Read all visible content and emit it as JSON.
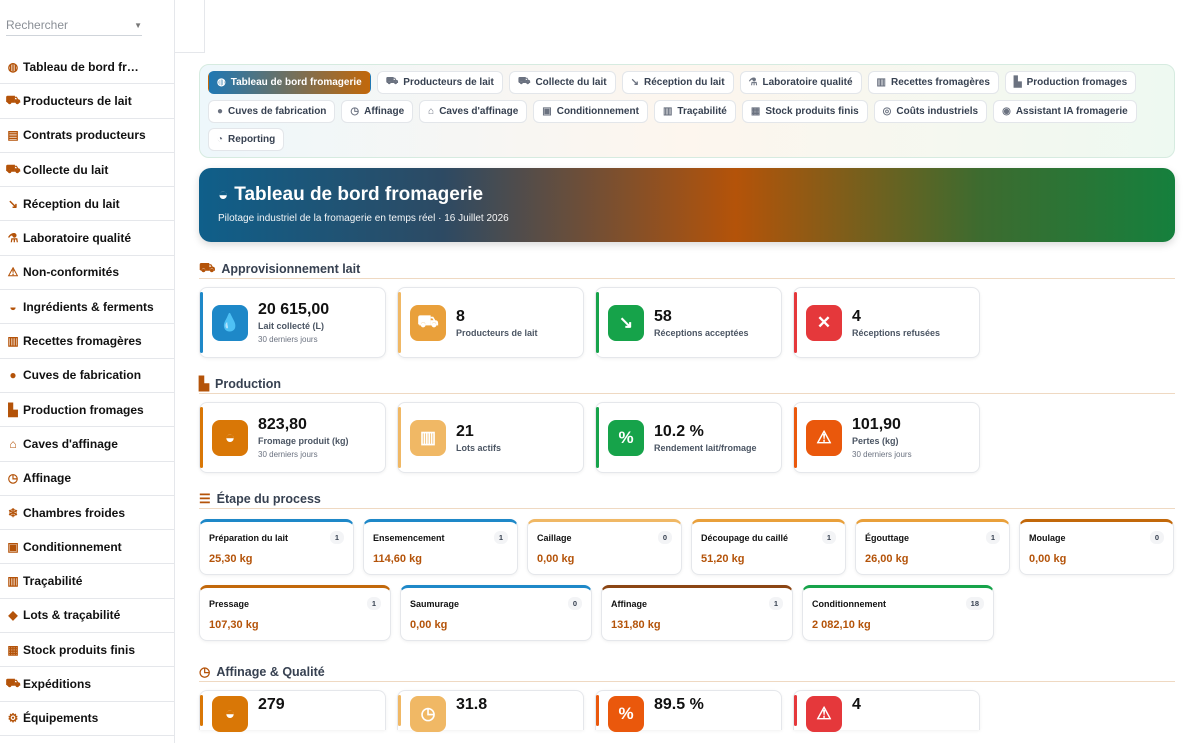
{
  "sidebar": {
    "search_placeholder": "Rechercher",
    "items": [
      {
        "label": "Tableau de bord fromagerie",
        "display": "Tableau de bord fromagerie",
        "icon": "gauge-icon",
        "glyph": "◍"
      },
      {
        "label": "Producteurs de lait",
        "icon": "tractor-icon",
        "glyph": "⛟"
      },
      {
        "label": "Contrats producteurs",
        "icon": "contract-icon",
        "glyph": "▤"
      },
      {
        "label": "Collecte du lait",
        "icon": "truck-icon",
        "glyph": "⛟"
      },
      {
        "label": "Réception du lait",
        "icon": "dolly-icon",
        "glyph": "↘"
      },
      {
        "label": "Laboratoire qualité",
        "icon": "microscope-icon",
        "glyph": "⚗"
      },
      {
        "label": "Non-conformités",
        "icon": "warning-icon",
        "glyph": "⚠"
      },
      {
        "label": "Ingrédients & ferments",
        "icon": "mortar-icon",
        "glyph": "◒"
      },
      {
        "label": "Recettes fromagères",
        "icon": "book-icon",
        "glyph": "▥"
      },
      {
        "label": "Cuves de fabrication",
        "icon": "droplet-icon",
        "glyph": "●"
      },
      {
        "label": "Production fromages",
        "icon": "industry-icon",
        "glyph": "▙"
      },
      {
        "label": "Caves d'affinage",
        "icon": "warehouse-icon",
        "glyph": "⌂"
      },
      {
        "label": "Affinage",
        "icon": "clock-icon",
        "glyph": "◷"
      },
      {
        "label": "Chambres froides",
        "icon": "snowflake-icon",
        "glyph": "❄"
      },
      {
        "label": "Conditionnement",
        "icon": "box-icon",
        "glyph": "▣"
      },
      {
        "label": "Traçabilité",
        "icon": "barcode-icon",
        "glyph": "▥"
      },
      {
        "label": "Lots & traçabilité",
        "icon": "tag-icon",
        "glyph": "◆"
      },
      {
        "label": "Stock produits finis",
        "icon": "boxes-icon",
        "glyph": "▦"
      },
      {
        "label": "Expéditions",
        "icon": "shipping-truck-icon",
        "glyph": "⛟"
      },
      {
        "label": "Équipements",
        "icon": "cogs-icon",
        "glyph": "⚙"
      }
    ]
  },
  "tabs": [
    {
      "label": "Tableau de bord fromagerie",
      "icon": "gauge-icon",
      "glyph": "◍",
      "active": true
    },
    {
      "label": "Producteurs de lait",
      "icon": "tractor-icon",
      "glyph": "⛟"
    },
    {
      "label": "Collecte du lait",
      "icon": "truck-icon",
      "glyph": "⛟"
    },
    {
      "label": "Réception du lait",
      "icon": "dolly-icon",
      "glyph": "↘"
    },
    {
      "label": "Laboratoire qualité",
      "icon": "microscope-icon",
      "glyph": "⚗"
    },
    {
      "label": "Recettes fromagères",
      "icon": "book-icon",
      "glyph": "▥"
    },
    {
      "label": "Production fromages",
      "icon": "industry-icon",
      "glyph": "▙"
    },
    {
      "label": "Cuves de fabrication",
      "icon": "droplet-icon",
      "glyph": "●"
    },
    {
      "label": "Affinage",
      "icon": "clock-icon",
      "glyph": "◷"
    },
    {
      "label": "Caves d'affinage",
      "icon": "warehouse-icon",
      "glyph": "⌂"
    },
    {
      "label": "Conditionnement",
      "icon": "box-icon",
      "glyph": "▣"
    },
    {
      "label": "Traçabilité",
      "icon": "barcode-icon",
      "glyph": "▥"
    },
    {
      "label": "Stock produits finis",
      "icon": "boxes-icon",
      "glyph": "▦"
    },
    {
      "label": "Coûts industriels",
      "icon": "coins-icon",
      "glyph": "◎"
    },
    {
      "label": "Assistant IA fromagerie",
      "icon": "brain-icon",
      "glyph": "◉"
    },
    {
      "label": "Reporting",
      "icon": "chart-pie-icon",
      "glyph": "◔"
    }
  ],
  "hero": {
    "title": "Tableau de bord fromagerie",
    "subtitle": "Pilotage industriel de la fromagerie en temps réel · 16 Juillet 2026",
    "icon": "cheese-icon"
  },
  "sections": {
    "supply": {
      "title": "Approvisionnement lait",
      "icon": "tractor-icon"
    },
    "production": {
      "title": "Production",
      "icon": "industry-icon"
    },
    "process": {
      "title": "Étape du process",
      "icon": "list-check-icon"
    },
    "aging": {
      "title": "Affinage & Qualité",
      "icon": "clock-icon"
    }
  },
  "supply_kpis": [
    {
      "value": "20 615,00",
      "label": "Lait collecté (L)",
      "sub": "30 derniers jours",
      "icon": "droplet-icon",
      "glyph": "💧",
      "color": "#1e88c8",
      "accent": "#1e88c8"
    },
    {
      "value": "8",
      "label": "Producteurs de lait",
      "sub": "",
      "icon": "tractor-icon",
      "glyph": "⛟",
      "color": "#e9a03b",
      "accent": "#f0b865"
    },
    {
      "value": "58",
      "label": "Réceptions acceptées",
      "sub": "",
      "icon": "dolly-icon",
      "glyph": "↘",
      "color": "#16a34a",
      "accent": "#16a34a"
    },
    {
      "value": "4",
      "label": "Réceptions refusées",
      "sub": "",
      "icon": "times-circle-icon",
      "glyph": "✕",
      "color": "#e5383b",
      "accent": "#e5383b"
    }
  ],
  "production_kpis": [
    {
      "value": "823,80",
      "label": "Fromage produit (kg)",
      "sub": "30 derniers jours",
      "icon": "cheese-icon",
      "glyph": "◒",
      "color": "#d97706",
      "accent": "#d97706"
    },
    {
      "value": "21",
      "label": "Lots actifs",
      "sub": "",
      "icon": "barcode-icon",
      "glyph": "▥",
      "color": "#f0b865",
      "accent": "#f0b865"
    },
    {
      "value": "10.2 %",
      "label": "Rendement lait/fromage",
      "sub": "",
      "icon": "percent-icon",
      "glyph": "%",
      "color": "#16a34a",
      "accent": "#16a34a"
    },
    {
      "value": "101,90",
      "label": "Pertes (kg)",
      "sub": "30 derniers jours",
      "icon": "warning-icon",
      "glyph": "⚠",
      "color": "#ea580c",
      "accent": "#ea580c"
    }
  ],
  "process_steps": [
    {
      "name": "Préparation du lait",
      "count": "1",
      "kg": "25,30 kg",
      "accent": "#1e88c8"
    },
    {
      "name": "Ensemencement",
      "count": "1",
      "kg": "114,60 kg",
      "accent": "#1e88c8"
    },
    {
      "name": "Caillage",
      "count": "0",
      "kg": "0,00 kg",
      "accent": "#f0b865"
    },
    {
      "name": "Découpage du caillé",
      "count": "1",
      "kg": "51,20 kg",
      "accent": "#e9a03b"
    },
    {
      "name": "Égouttage",
      "count": "1",
      "kg": "26,00 kg",
      "accent": "#e9a03b"
    },
    {
      "name": "Moulage",
      "count": "0",
      "kg": "0,00 kg",
      "accent": "#c2680a"
    },
    {
      "name": "Pressage",
      "count": "1",
      "kg": "107,30 kg",
      "accent": "#c2680a"
    },
    {
      "name": "Saumurage",
      "count": "0",
      "kg": "0,00 kg",
      "accent": "#1e88c8"
    },
    {
      "name": "Affinage",
      "count": "1",
      "kg": "131,80 kg",
      "accent": "#8b4513"
    },
    {
      "name": "Conditionnement",
      "count": "18",
      "kg": "2 082,10 kg",
      "accent": "#16a34a"
    }
  ],
  "aging_kpis": [
    {
      "value": "279",
      "icon": "cheese-icon",
      "glyph": "◒",
      "color": "#d97706",
      "accent": "#d97706"
    },
    {
      "value": "31.8",
      "icon": "clock-icon",
      "glyph": "◷",
      "color": "#f0b865",
      "accent": "#f0b865"
    },
    {
      "value": "89.5 %",
      "icon": "percent-icon",
      "glyph": "%",
      "color": "#ea580c",
      "accent": "#ea580c"
    },
    {
      "value": "4",
      "icon": "warning-icon",
      "glyph": "⚠",
      "color": "#e5383b",
      "accent": "#e5383b"
    }
  ]
}
